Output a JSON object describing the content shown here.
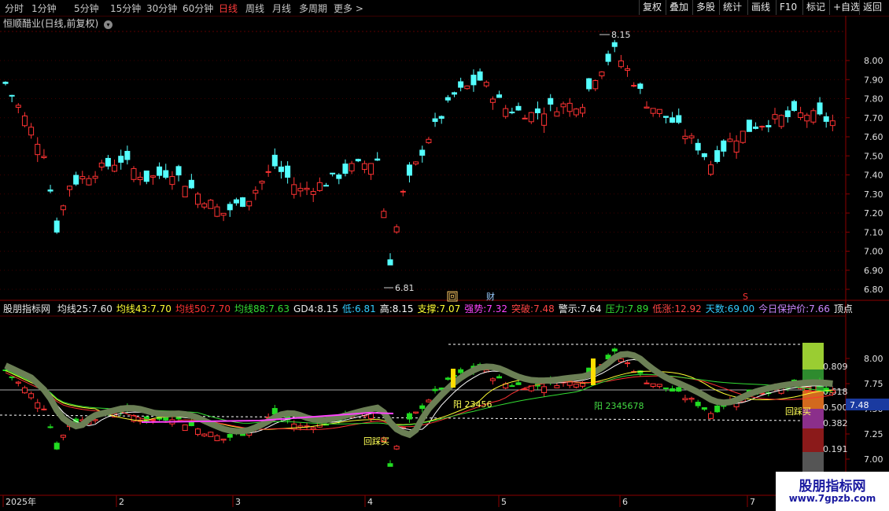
{
  "topbar": {
    "periods": [
      "分时",
      "1分钟",
      "5分钟",
      "15分钟",
      "30分钟",
      "60分钟",
      "日线",
      "周线",
      "月线",
      "多周期",
      "更多 >"
    ],
    "active_period": "日线",
    "right_buttons": [
      "复权",
      "叠加",
      "多股",
      "统计",
      "画线",
      "F10",
      "标记",
      "+自选",
      "返回"
    ]
  },
  "chart_title": "恒顺醋业(日线,前复权)",
  "main_axis": {
    "ticks": [
      "8.00",
      "7.90",
      "7.80",
      "7.70",
      "7.60",
      "7.50",
      "7.40",
      "7.30",
      "7.20",
      "7.10",
      "7.00",
      "6.90",
      "6.80"
    ],
    "high_label": "8.15",
    "low_label": "6.81",
    "marker_hui": "回",
    "marker_cai": "财",
    "marker_s": "S"
  },
  "indicator": {
    "name": "股朋指标网",
    "items": [
      {
        "label": "均线25:",
        "value": "7.60",
        "color": "#e8e8e8"
      },
      {
        "label": "均线43:",
        "value": "7.70",
        "color": "#ffff33"
      },
      {
        "label": "均线50:",
        "value": "7.70",
        "color": "#ff3333"
      },
      {
        "label": "均线88:",
        "value": "7.63",
        "color": "#33dd33"
      },
      {
        "label": "GD4:",
        "value": "8.15",
        "color": "#e8e8e8"
      },
      {
        "label": "低:",
        "value": "6.81",
        "color": "#33ccff"
      },
      {
        "label": "高:",
        "value": "8.15",
        "color": "#ffffff"
      },
      {
        "label": "支撑:",
        "value": "7.07",
        "color": "#ffff33"
      },
      {
        "label": "强势:",
        "value": "7.32",
        "color": "#ff44ff"
      },
      {
        "label": "突破:",
        "value": "7.48",
        "color": "#ff4444"
      },
      {
        "label": "警示:",
        "value": "7.64",
        "color": "#ffffff"
      },
      {
        "label": "压力:",
        "value": "7.89",
        "color": "#33dd33"
      },
      {
        "label": "低涨:",
        "value": "12.92",
        "color": "#ff4444"
      },
      {
        "label": "天数:",
        "value": "69.00",
        "color": "#33ccff"
      },
      {
        "label": "今日保护价:",
        "value": "7.66",
        "color": "#cc88ff"
      },
      {
        "label": "顶点",
        "value": "",
        "color": "#ffffff"
      }
    ]
  },
  "sub_axis": {
    "ticks": [
      "8.00",
      "7.75",
      "7.50",
      "7.25",
      "7.00"
    ],
    "fib": [
      "0.809",
      "0.618",
      "0.500",
      "0.382",
      "0.191"
    ],
    "current": "7.48"
  },
  "sub_labels": {
    "buy1": "回踩买",
    "buy2": "回踩买",
    "yang1": "阳 23456",
    "yang2": "阳 2345678"
  },
  "time_axis": {
    "labels": [
      "2025年",
      "2",
      "3",
      "4",
      "5",
      "6",
      "7"
    ]
  },
  "watermark": {
    "line1": "股朋指标网",
    "line2": "www.7gpzb.com"
  }
}
